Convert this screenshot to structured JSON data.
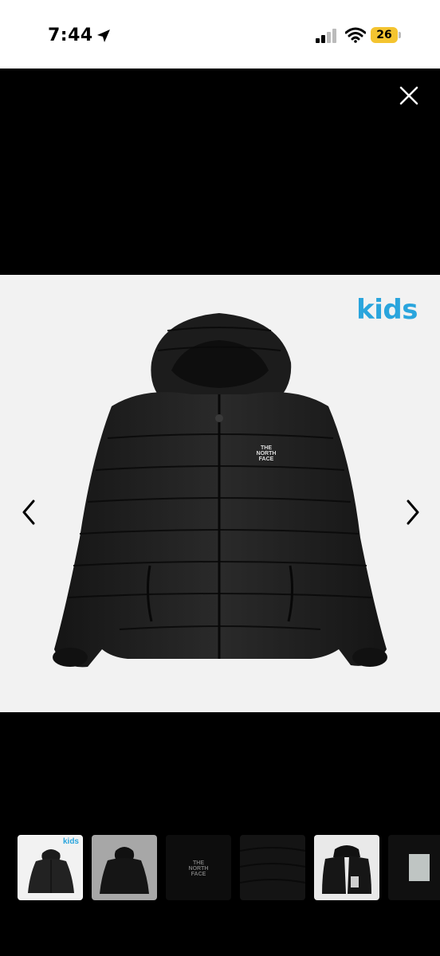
{
  "status_bar": {
    "time": "7:44",
    "battery": "26",
    "icons": [
      "location-arrow-icon",
      "cellular-signal-icon",
      "wifi-icon",
      "battery-icon"
    ]
  },
  "viewer": {
    "close_icon": "close-icon",
    "prev_icon": "chevron-left-icon",
    "next_icon": "chevron-right-icon",
    "image": {
      "brand_badge": "kids",
      "logo_lines": [
        "THE",
        "NORTH",
        "FACE"
      ]
    },
    "thumbnails": [
      {
        "badge": "kids",
        "active": true
      },
      {
        "badge": "",
        "active": false
      },
      {
        "badge": "",
        "active": false,
        "logo_lines": [
          "THE",
          "NORTH",
          "FACE"
        ]
      },
      {
        "badge": "",
        "active": false
      },
      {
        "badge": "",
        "active": false
      },
      {
        "badge": "",
        "active": false
      }
    ]
  },
  "colors": {
    "accent_kids": "#2aa5dd",
    "battery": "#f4c430",
    "background": "#000000",
    "panel": "#f2f2f2"
  }
}
